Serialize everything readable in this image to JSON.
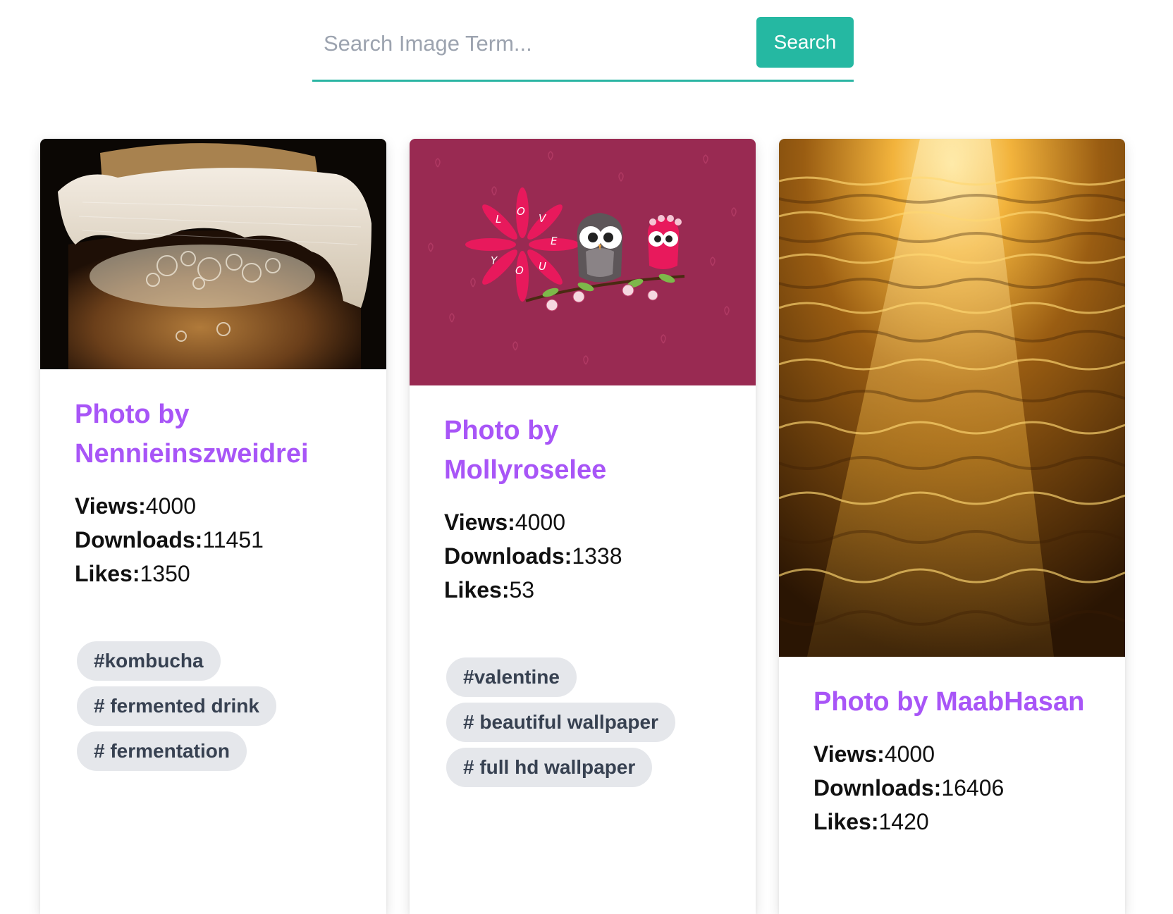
{
  "search": {
    "placeholder": "Search Image Term...",
    "button_label": "Search"
  },
  "cards": [
    {
      "image_alt": "Jar of kombucha covered with cheesecloth",
      "title": "Photo by Nennieinszweidrei",
      "views_label": "Views:",
      "views": "4000",
      "downloads_label": "Downloads:",
      "downloads": "11451",
      "likes_label": "Likes:",
      "likes": "1350",
      "tags": [
        "#kombucha",
        "# fermented drink",
        "# fermentation"
      ]
    },
    {
      "image_alt": "Valentine owls illustration",
      "title": "Photo by Mollyroselee",
      "views_label": "Views:",
      "views": "4000",
      "downloads_label": "Downloads:",
      "downloads": "1338",
      "likes_label": "Likes:",
      "likes": "53",
      "tags": [
        "#valentine",
        "# beautiful wallpaper",
        "# full hd wallpaper"
      ],
      "image_text": [
        "L",
        "O",
        "V",
        "E",
        "Y",
        "O",
        "U"
      ]
    },
    {
      "image_alt": "Golden sunlight reflecting on water",
      "title": "Photo by MaabHasan",
      "views_label": "Views:",
      "views": "4000",
      "downloads_label": "Downloads:",
      "downloads": "16406",
      "likes_label": "Likes:",
      "likes": "1420",
      "tags": []
    }
  ],
  "colors": {
    "accent": "#25b8a2",
    "title": "#a855f7",
    "tag_bg": "#e5e7eb",
    "valentine_bg": "#992a52"
  }
}
